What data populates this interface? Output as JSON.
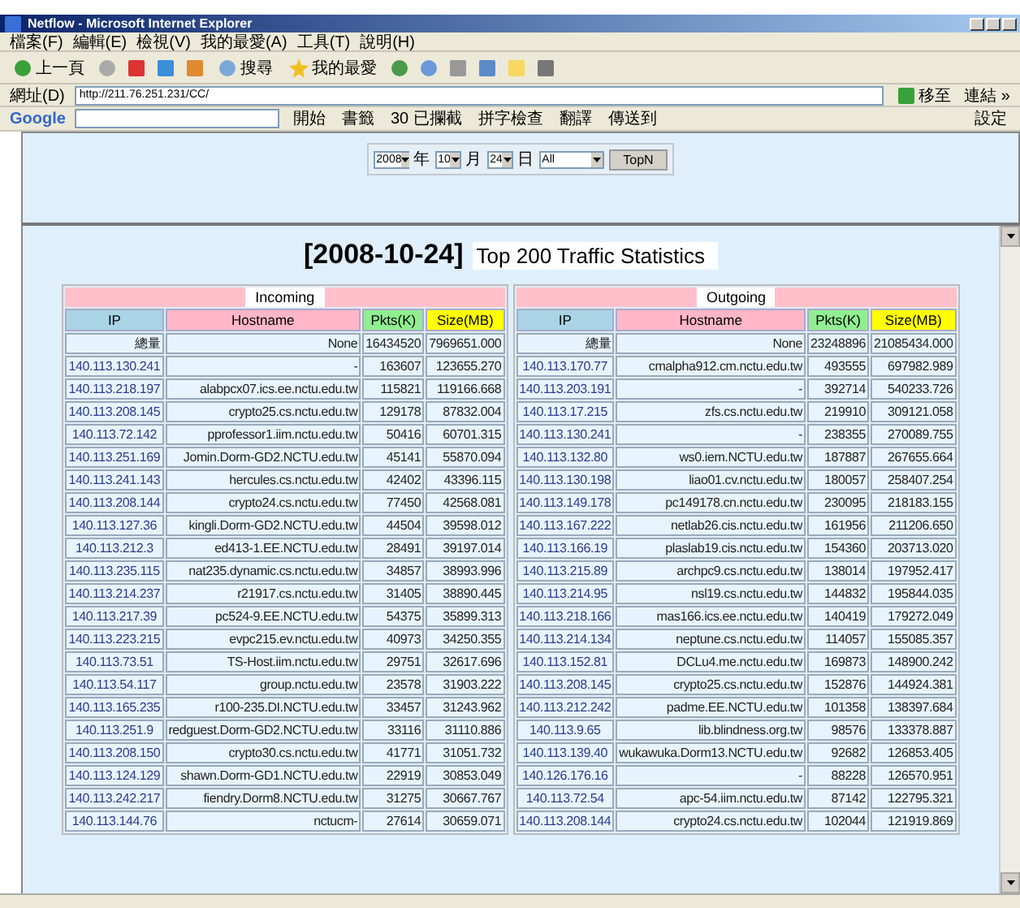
{
  "window": {
    "title": "Netflow - Microsoft Internet Explorer"
  },
  "menu": [
    "檔案(F)",
    "編輯(E)",
    "檢視(V)",
    "我的最愛(A)",
    "工具(T)",
    "說明(H)"
  ],
  "toolbar": {
    "back": "上一頁",
    "search": "搜尋",
    "favorites": "我的最愛"
  },
  "address_bar": {
    "label": "網址(D)",
    "url": "http://211.76.251.231/CC/",
    "go": "移至",
    "links": "連結 »"
  },
  "google_bar": {
    "logo": "Google",
    "start": "開始",
    "items": [
      "書籤",
      "30 已攔截",
      "拼字檢查",
      "翻譯",
      "傳送到"
    ],
    "settings": "設定"
  },
  "filter": {
    "year": "2008",
    "year_unit": "年",
    "month": "10",
    "month_unit": "月",
    "day": "24",
    "day_unit": "日",
    "category": "All",
    "button": "TopN"
  },
  "report": {
    "date": "[2008-10-24]",
    "title": "Top 200 Traffic Statistics"
  },
  "tables": [
    {
      "caption": "Incoming",
      "columns": [
        {
          "label": "IP",
          "color": "#a8d4e6"
        },
        {
          "label": "Hostname",
          "color": "#ffb6c8"
        },
        {
          "label": "Pkts(K)",
          "color": "#90ee90"
        },
        {
          "label": "Size(MB)",
          "color": "#ffff00"
        }
      ],
      "rows": [
        [
          "總量",
          "None",
          "16434520",
          "7969651.000"
        ],
        [
          "140.113.130.241",
          "-",
          "163607",
          "123655.270"
        ],
        [
          "140.113.218.197",
          "alabpcx07.ics.ee.nctu.edu.tw",
          "115821",
          "119166.668"
        ],
        [
          "140.113.208.145",
          "crypto25.cs.nctu.edu.tw",
          "129178",
          "87832.004"
        ],
        [
          "140.113.72.142",
          "pprofessor1.iim.nctu.edu.tw",
          "50416",
          "60701.315"
        ],
        [
          "140.113.251.169",
          "Jomin.Dorm-GD2.NCTU.edu.tw",
          "45141",
          "55870.094"
        ],
        [
          "140.113.241.143",
          "hercules.cs.nctu.edu.tw",
          "42402",
          "43396.115"
        ],
        [
          "140.113.208.144",
          "crypto24.cs.nctu.edu.tw",
          "77450",
          "42568.081"
        ],
        [
          "140.113.127.36",
          "kingli.Dorm-GD2.NCTU.edu.tw",
          "44504",
          "39598.012"
        ],
        [
          "140.113.212.3",
          "ed413-1.EE.NCTU.edu.tw",
          "28491",
          "39197.014"
        ],
        [
          "140.113.235.115",
          "nat235.dynamic.cs.nctu.edu.tw",
          "34857",
          "38993.996"
        ],
        [
          "140.113.214.237",
          "r21917.cs.nctu.edu.tw",
          "31405",
          "38890.445"
        ],
        [
          "140.113.217.39",
          "pc524-9.EE.NCTU.edu.tw",
          "54375",
          "35899.313"
        ],
        [
          "140.113.223.215",
          "evpc215.ev.nctu.edu.tw",
          "40973",
          "34250.355"
        ],
        [
          "140.113.73.51",
          "TS-Host.iim.nctu.edu.tw",
          "29751",
          "32617.696"
        ],
        [
          "140.113.54.117",
          "group.nctu.edu.tw",
          "23578",
          "31903.222"
        ],
        [
          "140.113.165.235",
          "r100-235.DI.NCTU.edu.tw",
          "33457",
          "31243.962"
        ],
        [
          "140.113.251.9",
          "redguest.Dorm-GD2.NCTU.edu.tw",
          "33116",
          "31110.886"
        ],
        [
          "140.113.208.150",
          "crypto30.cs.nctu.edu.tw",
          "41771",
          "31051.732"
        ],
        [
          "140.113.124.129",
          "shawn.Dorm-GD1.NCTU.edu.tw",
          "22919",
          "30853.049"
        ],
        [
          "140.113.242.217",
          "fiendry.Dorm8.NCTU.edu.tw",
          "31275",
          "30667.767"
        ],
        [
          "140.113.144.76",
          "nctucm-",
          "27614",
          "30659.071"
        ]
      ]
    },
    {
      "caption": "Outgoing",
      "columns": [
        {
          "label": "IP",
          "color": "#a8d4e6"
        },
        {
          "label": "Hostname",
          "color": "#ffb6c8"
        },
        {
          "label": "Pkts(K)",
          "color": "#90ee90"
        },
        {
          "label": "Size(MB)",
          "color": "#ffff00"
        }
      ],
      "rows": [
        [
          "總量",
          "None",
          "23248896",
          "21085434.000"
        ],
        [
          "140.113.170.77",
          "cmalpha912.cm.nctu.edu.tw",
          "493555",
          "697982.989"
        ],
        [
          "140.113.203.191",
          "-",
          "392714",
          "540233.726"
        ],
        [
          "140.113.17.215",
          "zfs.cs.nctu.edu.tw",
          "219910",
          "309121.058"
        ],
        [
          "140.113.130.241",
          "-",
          "238355",
          "270089.755"
        ],
        [
          "140.113.132.80",
          "ws0.iem.NCTU.edu.tw",
          "187887",
          "267655.664"
        ],
        [
          "140.113.130.198",
          "liao01.cv.nctu.edu.tw",
          "180057",
          "258407.254"
        ],
        [
          "140.113.149.178",
          "pc149178.cn.nctu.edu.tw",
          "230095",
          "218183.155"
        ],
        [
          "140.113.167.222",
          "netlab26.cis.nctu.edu.tw",
          "161956",
          "211206.650"
        ],
        [
          "140.113.166.19",
          "plaslab19.cis.nctu.edu.tw",
          "154360",
          "203713.020"
        ],
        [
          "140.113.215.89",
          "archpc9.cs.nctu.edu.tw",
          "138014",
          "197952.417"
        ],
        [
          "140.113.214.95",
          "nsl19.cs.nctu.edu.tw",
          "144832",
          "195844.035"
        ],
        [
          "140.113.218.166",
          "mas166.ics.ee.nctu.edu.tw",
          "140419",
          "179272.049"
        ],
        [
          "140.113.214.134",
          "neptune.cs.nctu.edu.tw",
          "114057",
          "155085.357"
        ],
        [
          "140.113.152.81",
          "DCLu4.me.nctu.edu.tw",
          "169873",
          "148900.242"
        ],
        [
          "140.113.208.145",
          "crypto25.cs.nctu.edu.tw",
          "152876",
          "144924.381"
        ],
        [
          "140.113.212.242",
          "padme.EE.NCTU.edu.tw",
          "101358",
          "138397.684"
        ],
        [
          "140.113.9.65",
          "lib.blindness.org.tw",
          "98576",
          "133378.887"
        ],
        [
          "140.113.139.40",
          "wukawuka.Dorm13.NCTU.edu.tw",
          "92682",
          "126853.405"
        ],
        [
          "140.126.176.16",
          "-",
          "88228",
          "126570.951"
        ],
        [
          "140.113.72.54",
          "apc-54.iim.nctu.edu.tw",
          "87142",
          "122795.321"
        ],
        [
          "140.113.208.144",
          "crypto24.cs.nctu.edu.tw",
          "102044",
          "121919.869"
        ]
      ]
    }
  ]
}
